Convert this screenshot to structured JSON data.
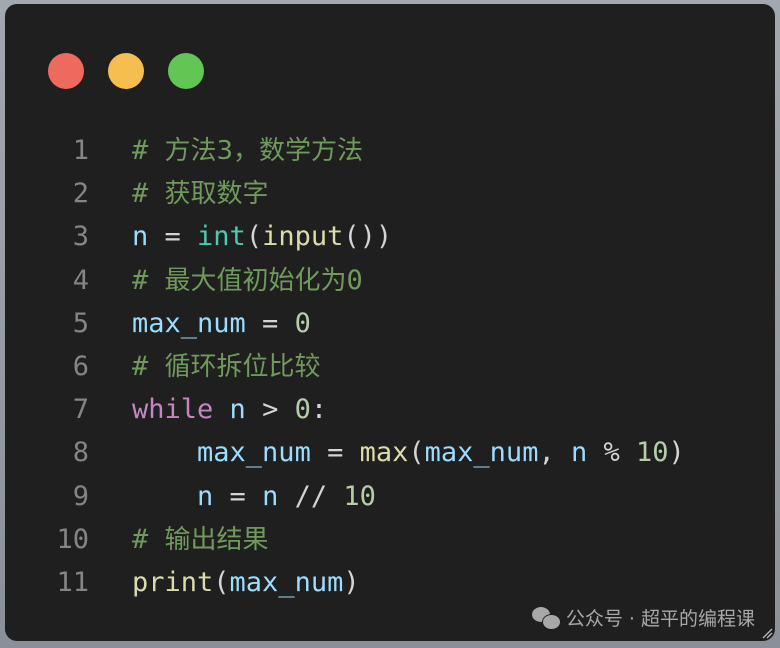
{
  "window": {
    "controls": [
      {
        "name": "close",
        "color": "#ee6a5f"
      },
      {
        "name": "minimize",
        "color": "#f5be4f"
      },
      {
        "name": "maximize",
        "color": "#62c655"
      }
    ]
  },
  "code": {
    "language": "python",
    "lines": [
      {
        "n": "1",
        "tokens": [
          {
            "t": "cm",
            "v": "# "
          },
          {
            "t": "cm cjk",
            "v": "方法3，数学方法"
          }
        ]
      },
      {
        "n": "2",
        "tokens": [
          {
            "t": "cm",
            "v": "# "
          },
          {
            "t": "cm cjk",
            "v": "获取数字"
          }
        ]
      },
      {
        "n": "3",
        "tokens": [
          {
            "t": "var",
            "v": "n"
          },
          {
            "t": "op",
            "v": " = "
          },
          {
            "t": "cls",
            "v": "int"
          },
          {
            "t": "pn",
            "v": "("
          },
          {
            "t": "fn",
            "v": "input"
          },
          {
            "t": "pn",
            "v": "())"
          }
        ]
      },
      {
        "n": "4",
        "tokens": [
          {
            "t": "cm",
            "v": "# "
          },
          {
            "t": "cm cjk",
            "v": "最大值初始化为"
          },
          {
            "t": "cm",
            "v": "0"
          }
        ]
      },
      {
        "n": "5",
        "tokens": [
          {
            "t": "var",
            "v": "max_num"
          },
          {
            "t": "op",
            "v": " = "
          },
          {
            "t": "num",
            "v": "0"
          }
        ]
      },
      {
        "n": "6",
        "tokens": [
          {
            "t": "cm",
            "v": "# "
          },
          {
            "t": "cm cjk",
            "v": "循环拆位比较"
          }
        ]
      },
      {
        "n": "7",
        "tokens": [
          {
            "t": "kw",
            "v": "while"
          },
          {
            "t": "op",
            "v": " "
          },
          {
            "t": "var",
            "v": "n"
          },
          {
            "t": "op",
            "v": " > "
          },
          {
            "t": "num",
            "v": "0"
          },
          {
            "t": "op",
            "v": ":"
          }
        ]
      },
      {
        "n": "8",
        "tokens": [
          {
            "t": "op",
            "v": "    "
          },
          {
            "t": "var",
            "v": "max_num"
          },
          {
            "t": "op",
            "v": " = "
          },
          {
            "t": "fn",
            "v": "max"
          },
          {
            "t": "pn",
            "v": "("
          },
          {
            "t": "var",
            "v": "max_num"
          },
          {
            "t": "op",
            "v": ", "
          },
          {
            "t": "var",
            "v": "n"
          },
          {
            "t": "op",
            "v": " % "
          },
          {
            "t": "num",
            "v": "10"
          },
          {
            "t": "pn",
            "v": ")"
          }
        ]
      },
      {
        "n": "9",
        "tokens": [
          {
            "t": "op",
            "v": "    "
          },
          {
            "t": "var",
            "v": "n"
          },
          {
            "t": "op",
            "v": " = "
          },
          {
            "t": "var",
            "v": "n"
          },
          {
            "t": "op",
            "v": " // "
          },
          {
            "t": "num",
            "v": "10"
          }
        ]
      },
      {
        "n": "10",
        "tokens": [
          {
            "t": "cm",
            "v": "# "
          },
          {
            "t": "cm cjk",
            "v": "输出结果"
          }
        ]
      },
      {
        "n": "11",
        "tokens": [
          {
            "t": "fn",
            "v": "print"
          },
          {
            "t": "pn",
            "v": "("
          },
          {
            "t": "var",
            "v": "max_num"
          },
          {
            "t": "pn",
            "v": ")"
          }
        ]
      }
    ]
  },
  "watermark": {
    "icon": "wechat-icon",
    "text": "公众号 · 超平的编程课"
  }
}
